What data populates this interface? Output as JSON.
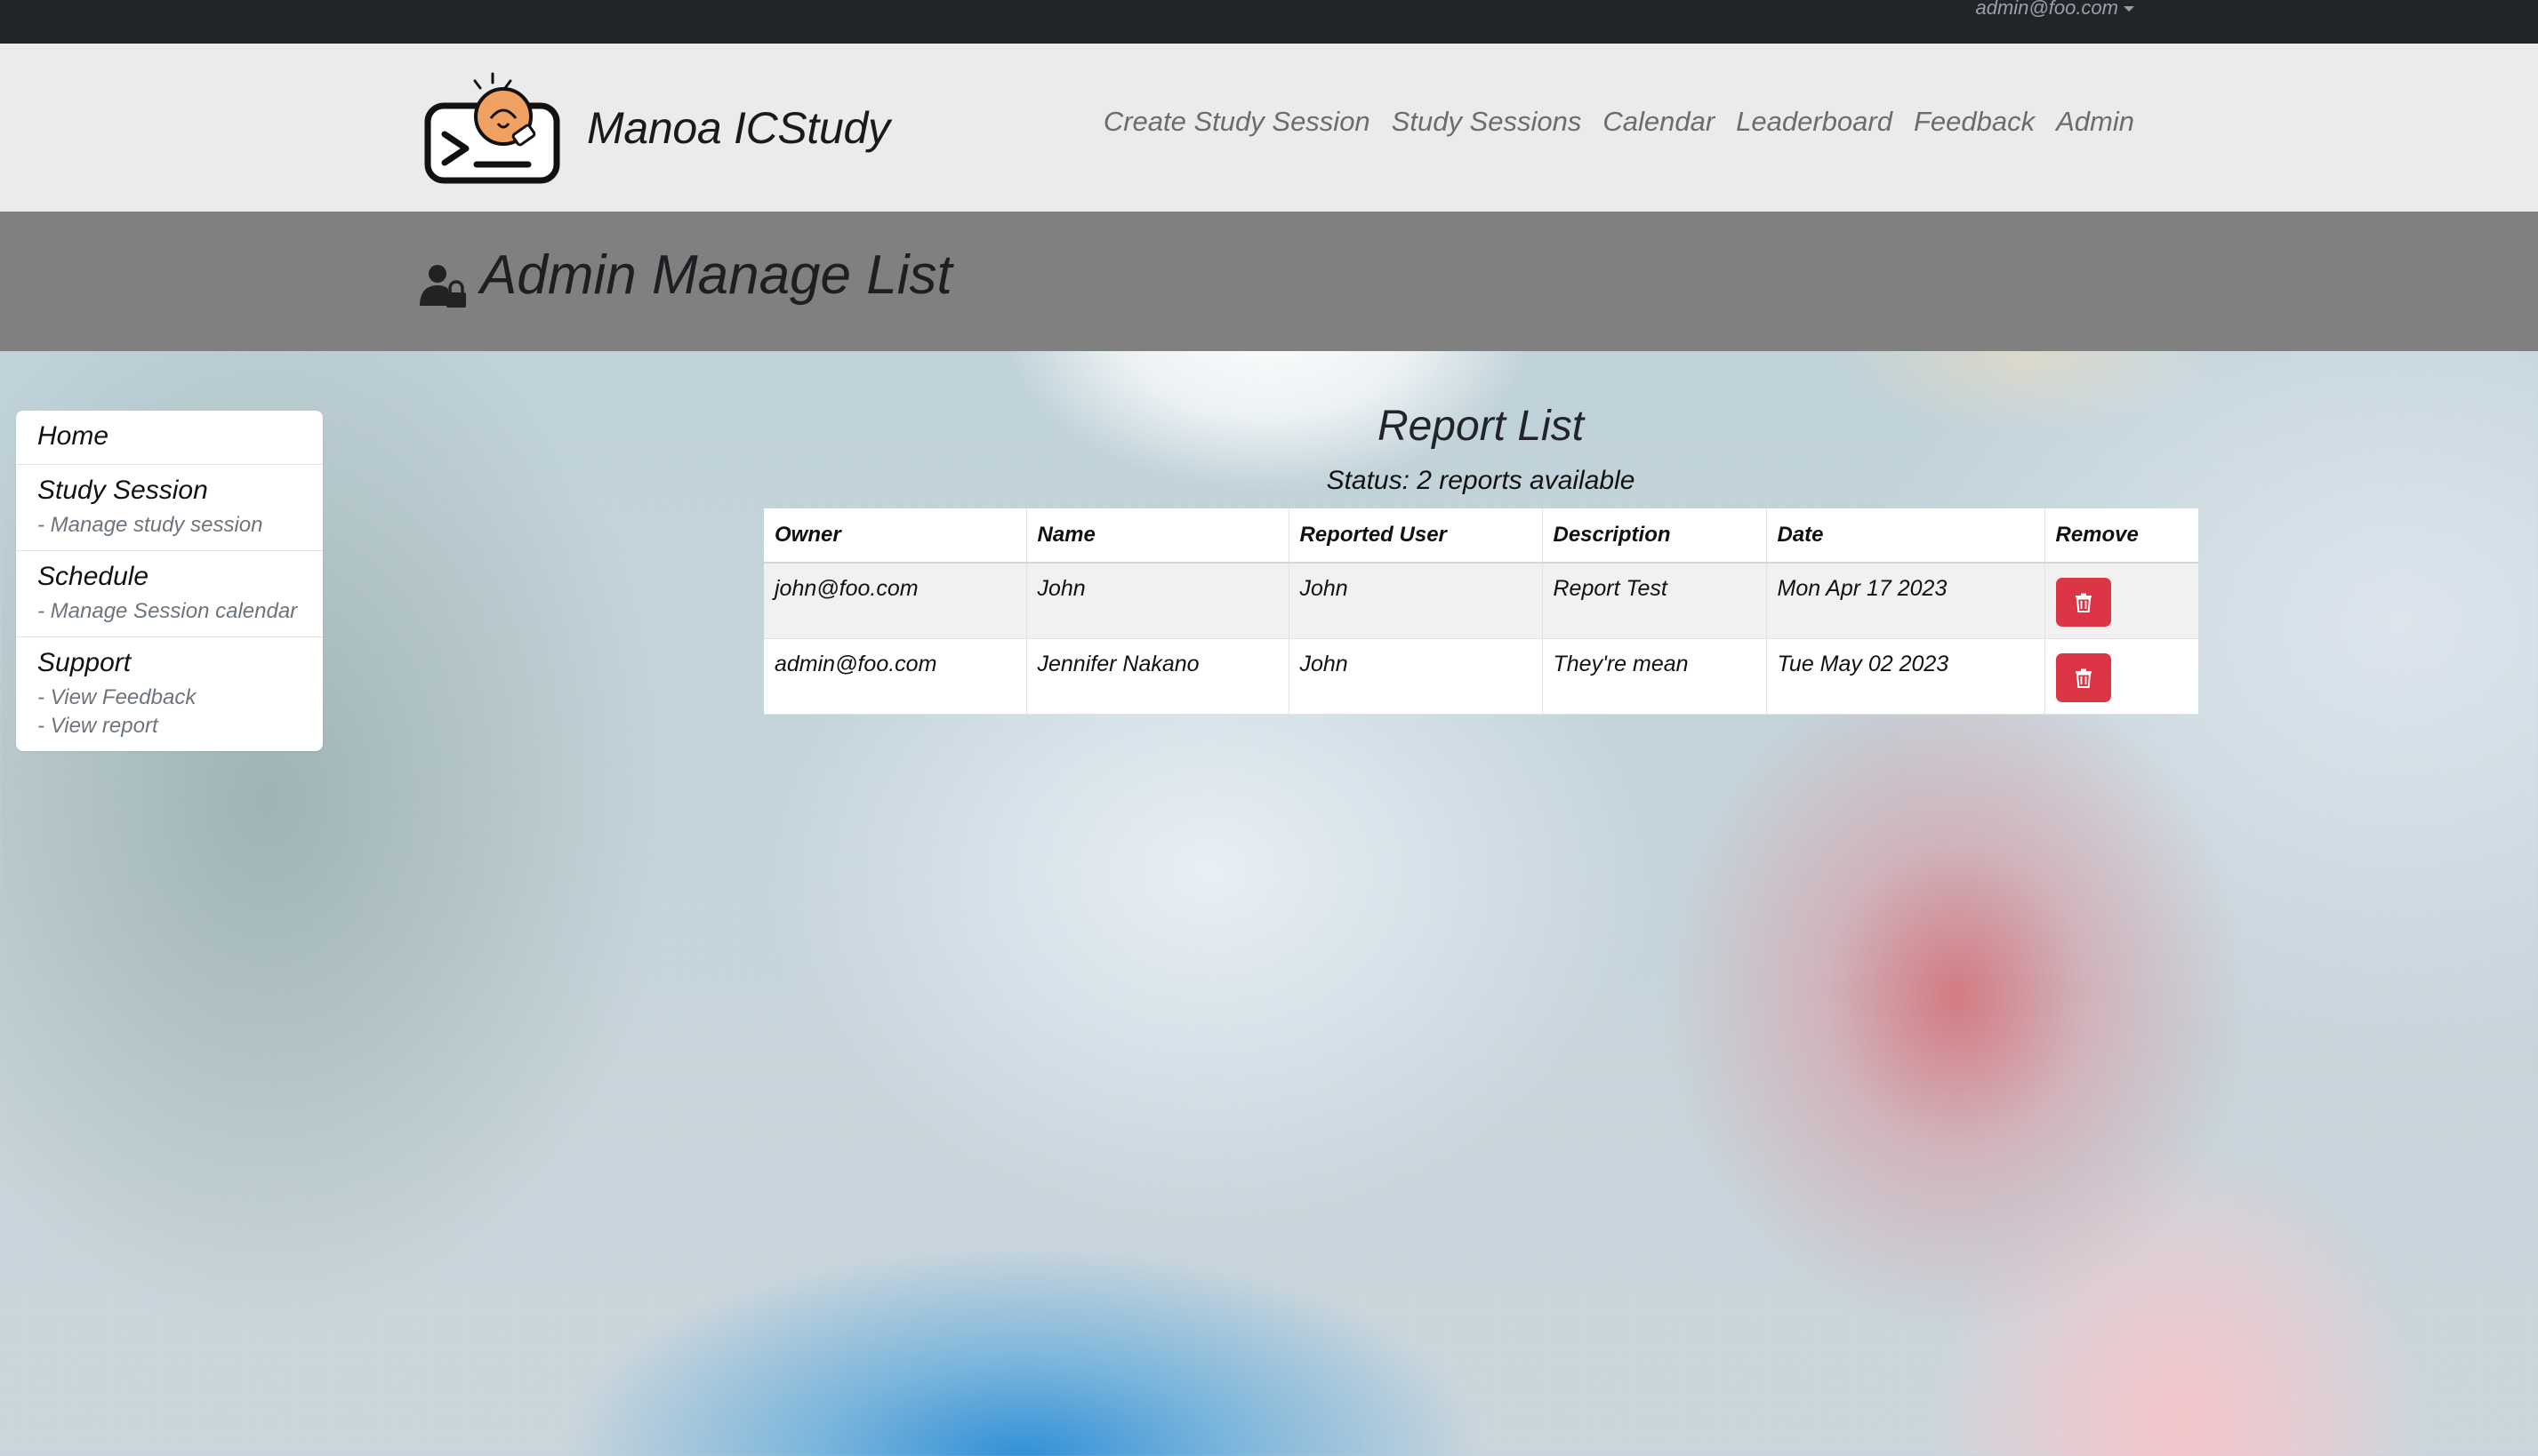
{
  "topbar": {
    "user_email": "admin@foo.com"
  },
  "navbar": {
    "brand": "Manoa ICStudy",
    "links": [
      {
        "label": "Create Study Session"
      },
      {
        "label": "Study Sessions"
      },
      {
        "label": "Calendar"
      },
      {
        "label": "Leaderboard"
      },
      {
        "label": "Feedback"
      },
      {
        "label": "Admin"
      }
    ]
  },
  "header": {
    "title": "Admin Manage List",
    "icon": "user-lock-icon"
  },
  "sidebar": {
    "sections": [
      {
        "title": "Home",
        "items": []
      },
      {
        "title": "Study Session",
        "items": [
          "- Manage study session"
        ]
      },
      {
        "title": "Schedule",
        "items": [
          "- Manage Session calendar"
        ]
      },
      {
        "title": "Support",
        "items": [
          "- View Feedback",
          "- View report"
        ]
      }
    ]
  },
  "main": {
    "title": "Report List",
    "status": "Status: 2 reports available",
    "columns": [
      "Owner",
      "Name",
      "Reported User",
      "Description",
      "Date",
      "Remove"
    ],
    "rows": [
      {
        "owner": "john@foo.com",
        "name": "John",
        "reported_user": "John",
        "description": "Report Test",
        "date": "Mon Apr 17 2023"
      },
      {
        "owner": "admin@foo.com",
        "name": "Jennifer Nakano",
        "reported_user": "John",
        "description": "They're mean",
        "date": "Tue May 02 2023"
      }
    ]
  },
  "colors": {
    "topbar": "#212529",
    "navbar": "#ebebeb",
    "titlebar": "#808080",
    "danger": "#dc3545",
    "logo_orange": "#f0a060"
  }
}
